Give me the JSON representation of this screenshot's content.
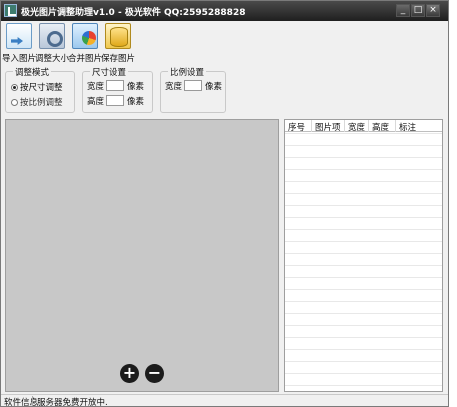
{
  "window": {
    "title": "极光图片调整助理v1.0 - 极光软件 QQ:2595288828",
    "controls": {
      "minimize": "_",
      "maximize": "□",
      "close": "×"
    }
  },
  "toolbar": {
    "items": [
      {
        "label": "导入图片",
        "icon": "import-image-icon"
      },
      {
        "label": "调整大小",
        "icon": "resize-icon"
      },
      {
        "label": "合并图片",
        "icon": "merge-image-icon"
      },
      {
        "label": "保存图片",
        "icon": "save-image-icon"
      }
    ]
  },
  "mode_group": {
    "title": "调整模式",
    "options": [
      {
        "label": "按尺寸调整",
        "selected": true
      },
      {
        "label": "按比例调整",
        "selected": false
      }
    ]
  },
  "size_group": {
    "title": "尺寸设置",
    "width_label": "宽度",
    "height_label": "高度",
    "unit": "像素",
    "width_value": "",
    "height_value": ""
  },
  "ratio_group": {
    "title": "比例设置",
    "width_label": "宽度",
    "unit": "像素",
    "width_value": ""
  },
  "preview": {
    "zoom_in": "+",
    "zoom_out": "−"
  },
  "file_list": {
    "columns": [
      "序号",
      "图片项",
      "宽度",
      "高度",
      "标注"
    ],
    "rows": []
  },
  "status": {
    "label": "软件信息",
    "text": "服务器免费开放中."
  }
}
